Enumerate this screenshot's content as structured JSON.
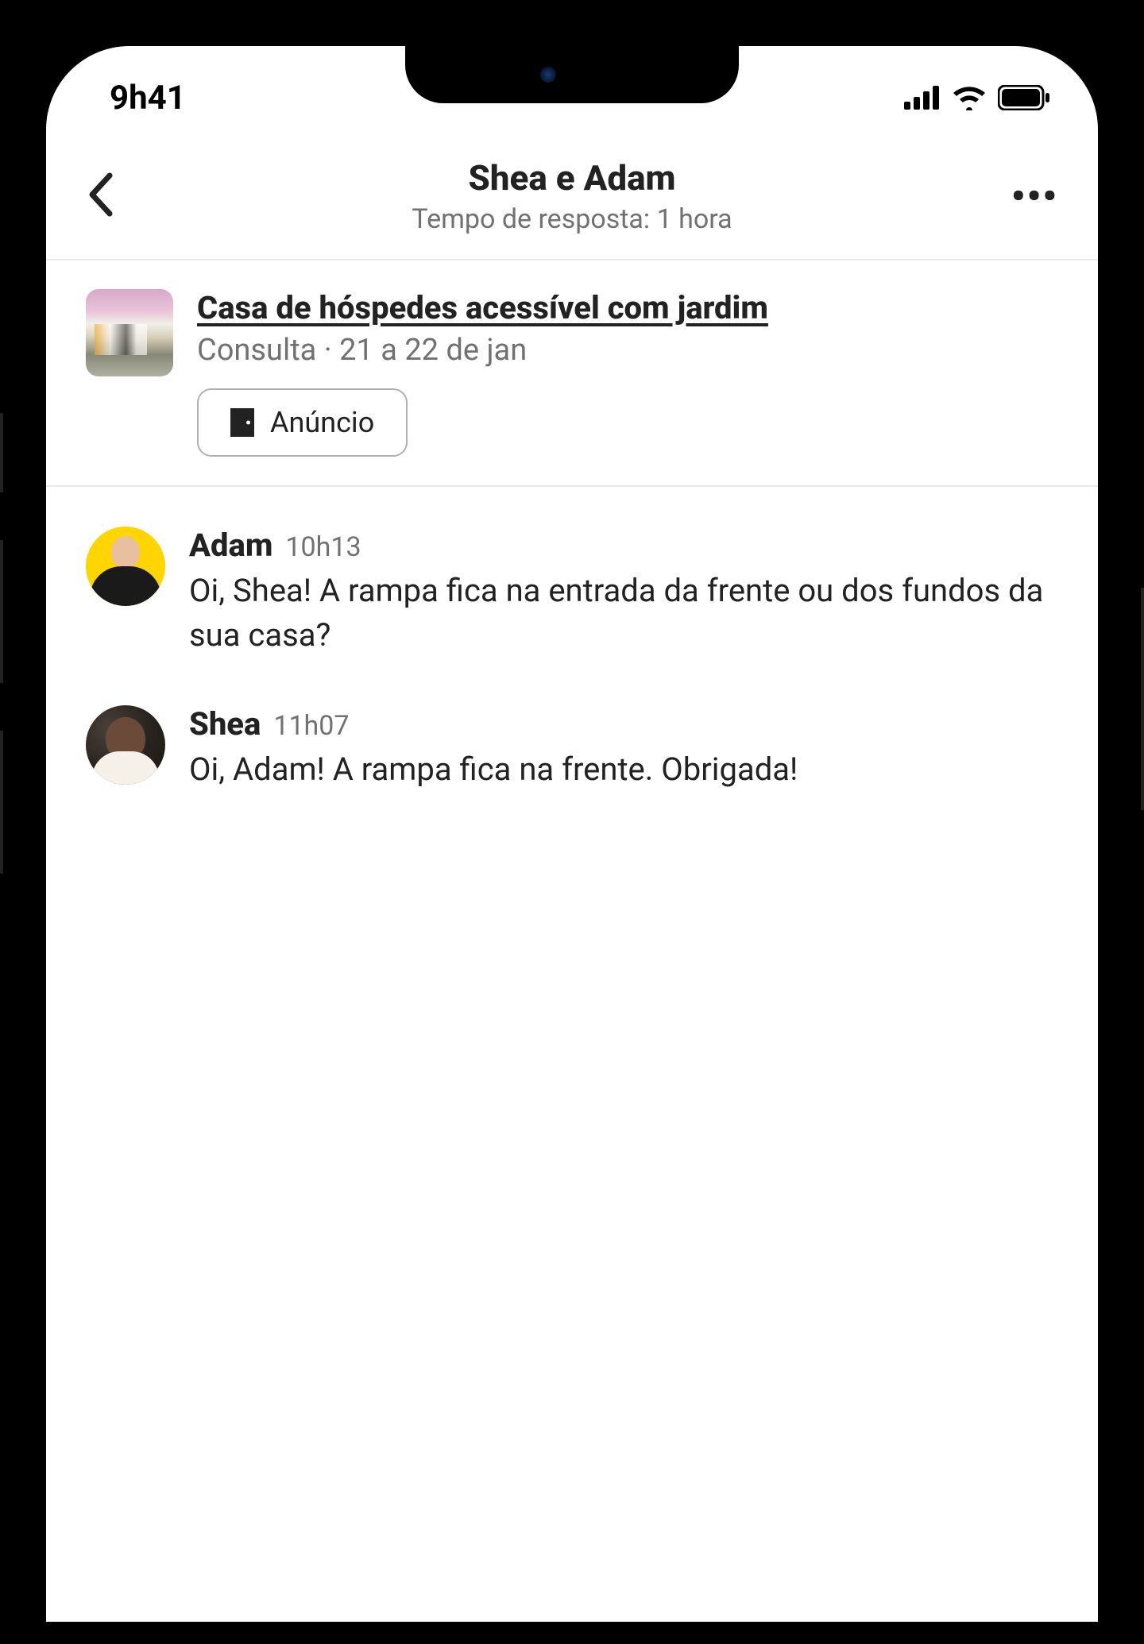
{
  "status": {
    "time": "9h41"
  },
  "header": {
    "title": "Shea e Adam",
    "subtitle": "Tempo de resposta: 1 hora"
  },
  "listing": {
    "title": "Casa de hóspedes acessível com jardim",
    "status": "Consulta",
    "separator": " · ",
    "dates": "21 a 22 de jan",
    "button_label": "Anúncio"
  },
  "messages": [
    {
      "author": "Adam",
      "time": "10h13",
      "text": "Oi, Shea! A rampa fica na entrada da frente ou dos fundos da sua casa?"
    },
    {
      "author": "Shea",
      "time": "11h07",
      "text": "Oi, Adam! A rampa fica na frente. Obrigada!"
    }
  ]
}
